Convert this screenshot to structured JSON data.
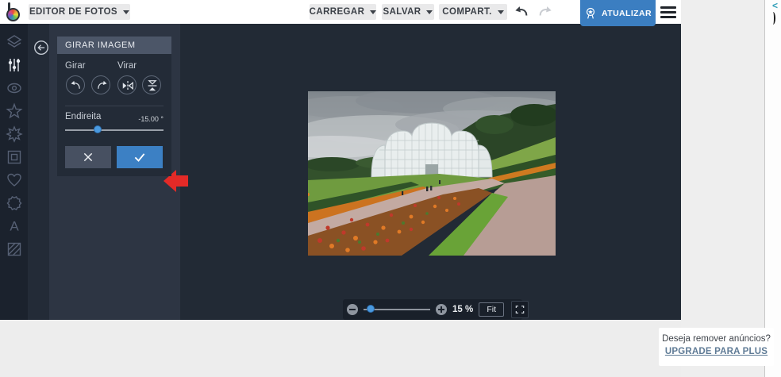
{
  "topbar": {
    "app_menu_label": "EDITOR DE FOTOS",
    "carregar_label": "CARREGAR",
    "salvar_label": "SALVAR",
    "compart_label": "COMPART.",
    "atualizar_label": "ATUALIZAR"
  },
  "sidebar": {
    "tools": [
      "layers",
      "adjustments",
      "eye",
      "star",
      "effects",
      "frame",
      "heart",
      "badge",
      "text",
      "pattern"
    ],
    "active_tool": "adjustments",
    "text_glyph": "A"
  },
  "panel": {
    "title": "GIRAR IMAGEM",
    "girar_label": "Girar",
    "virar_label": "Virar",
    "straighten_label": "Endireita",
    "straighten_value": "-15.00 °",
    "straighten_slider_percent": 33
  },
  "zoombar": {
    "zoom_value": "15 %",
    "fit_label": "Fit",
    "zoom_slider_percent": 7
  },
  "ad": {
    "question": "Deseja remover anúncios?",
    "link_label": "UPGRADE PARA PLUS",
    "collapse_glyph": "<"
  },
  "colors": {
    "accent_blue": "#3c80c4",
    "atualizar_blue": "#3b7ec1",
    "arrow_red": "#e42a27",
    "editor_bg": "#222a35",
    "panel_bg": "#232b37",
    "panel_header_bg": "#4c5668",
    "topbar_button_bg": "#e9e9ea",
    "ad_link_color": "#5f7b96"
  }
}
